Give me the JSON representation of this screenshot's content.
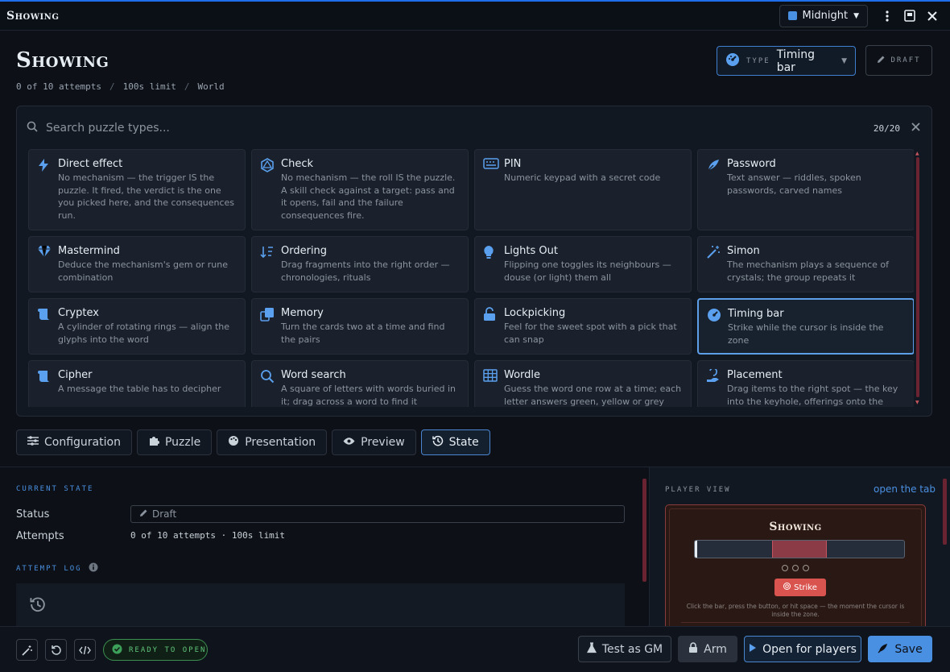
{
  "window": {
    "title": "Showing",
    "theme": "Midnight"
  },
  "header": {
    "title": "Showing",
    "meta": [
      "0 of 10 attempts",
      "100s limit",
      "World"
    ],
    "type_label": "TYPE",
    "type_value": "Timing bar",
    "draft_label": "DRAFT"
  },
  "picker": {
    "placeholder": "Search puzzle types...",
    "count": "20/20",
    "cards": [
      {
        "title": "Direct effect",
        "desc": "No mechanism — the trigger IS the puzzle. It fired, the verdict is the one you picked here, and the consequences run.",
        "icon": "bolt-icon"
      },
      {
        "title": "Check",
        "desc": "No mechanism — the roll IS the puzzle. A skill check against a target: pass and it opens, fail and the failure consequences fire.",
        "icon": "d20-icon"
      },
      {
        "title": "PIN",
        "desc": "Numeric keypad with a secret code",
        "icon": "keypad-icon"
      },
      {
        "title": "Password",
        "desc": "Text answer — riddles, spoken passwords, carved names",
        "icon": "feather-icon"
      },
      {
        "title": "Mastermind",
        "desc": "Deduce the mechanism's gem or rune combination",
        "icon": "gem-icon"
      },
      {
        "title": "Ordering",
        "desc": "Drag fragments into the right order — chronologies, rituals",
        "icon": "sort-icon"
      },
      {
        "title": "Lights Out",
        "desc": "Flipping one toggles its neighbours — douse (or light) them all",
        "icon": "lightbulb-icon"
      },
      {
        "title": "Simon",
        "desc": "The mechanism plays a sequence of crystals; the group repeats it",
        "icon": "wand-icon"
      },
      {
        "title": "Cryptex",
        "desc": "A cylinder of rotating rings — align the glyphs into the word",
        "icon": "scroll-icon"
      },
      {
        "title": "Memory",
        "desc": "Turn the cards two at a time and find the pairs",
        "icon": "cards-icon"
      },
      {
        "title": "Lockpicking",
        "desc": "Feel for the sweet spot with a pick that can snap",
        "icon": "unlock-icon"
      },
      {
        "title": "Timing bar",
        "desc": "Strike while the cursor is inside the zone",
        "icon": "gauge-icon"
      },
      {
        "title": "Cipher",
        "desc": "A message the table has to decipher",
        "icon": "scroll-icon"
      },
      {
        "title": "Word search",
        "desc": "A square of letters with words buried in it; drag across a word to find it",
        "icon": "magnifier-icon"
      },
      {
        "title": "Wordle",
        "desc": "Guess the word one row at a time; each letter answers green, yellow or grey",
        "icon": "grid-icon"
      },
      {
        "title": "Placement",
        "desc": "Drag items to the right spot — the key into the keyhole, offerings onto the altar",
        "icon": "hand-icon"
      }
    ]
  },
  "tabs": [
    "Configuration",
    "Puzzle",
    "Presentation",
    "Preview",
    "State"
  ],
  "state": {
    "section_label": "CURRENT STATE",
    "status_label": "Status",
    "status_value": "Draft",
    "attempts_label": "Attempts",
    "attempts_value": "0 of 10 attempts · 100s limit",
    "log_label": "ATTEMPT LOG"
  },
  "player_view": {
    "label": "PLAYER VIEW",
    "link": "open the tab",
    "title": "Showing",
    "strike_label": "Strike",
    "hint": "Click the bar, press the button, or hit space — the moment the cursor is inside the zone.",
    "zone_start": 0.37,
    "zone_end": 0.63,
    "cursor_position": 0.0,
    "dots": 3
  },
  "footer": {
    "ready_label": "READY TO OPEN",
    "test_label": "Test as GM",
    "arm_label": "Arm",
    "open_label": "Open for players",
    "save_label": "Save"
  },
  "colors": {
    "accent": "#4a90e2",
    "danger": "#d9534f",
    "success": "#5fc47a",
    "save": "#4a90e2"
  }
}
